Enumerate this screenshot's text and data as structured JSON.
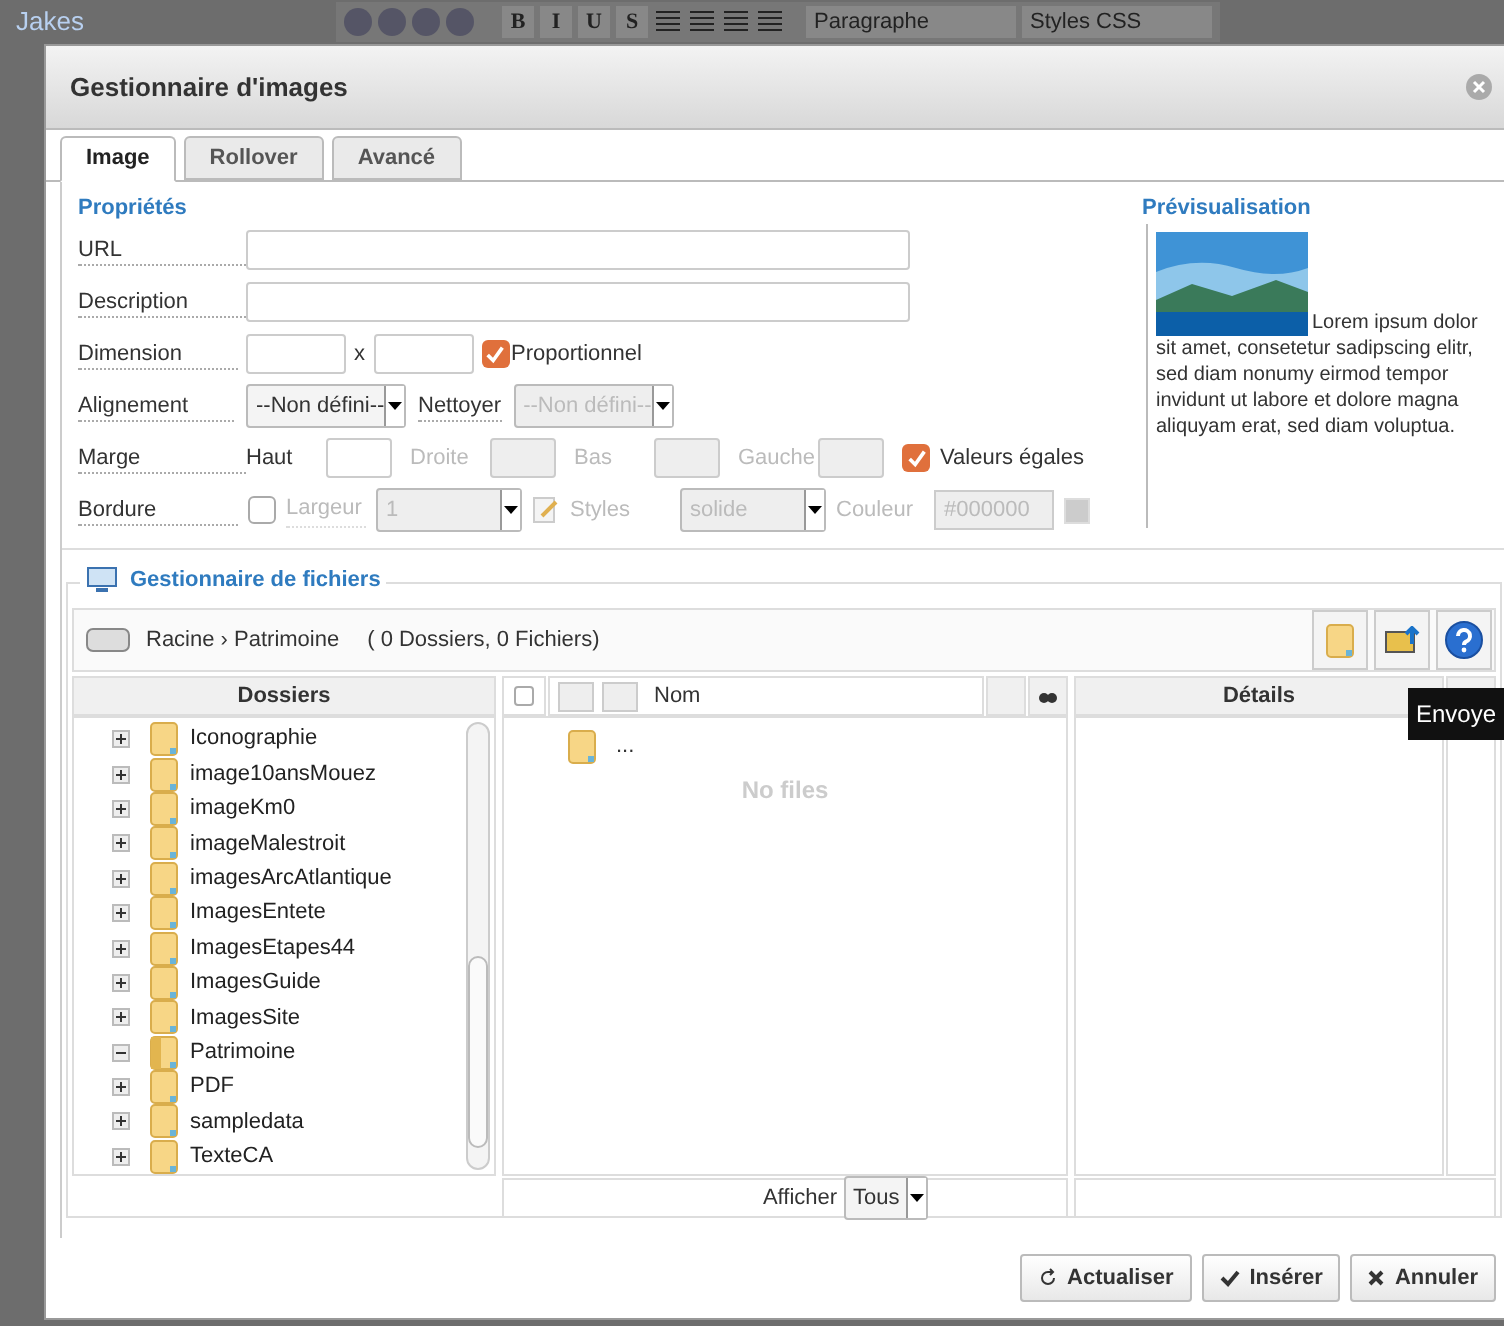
{
  "background": {
    "title": "Jakes",
    "format_buttons": [
      "B",
      "I",
      "U",
      "S"
    ],
    "format_select": "Paragraphe",
    "styles_select": "Styles CSS"
  },
  "dialog": {
    "title": "Gestionnaire d'images",
    "tabs": [
      {
        "label": "Image",
        "selected": true
      },
      {
        "label": "Rollover",
        "selected": false
      },
      {
        "label": "Avancé",
        "selected": false
      }
    ],
    "properties": {
      "legend": "Propriétés",
      "url_label": "URL",
      "description_label": "Description",
      "dimension_label": "Dimension",
      "dimension_separator": "x",
      "proportional": {
        "label": "Proportionnel",
        "checked": true
      },
      "alignment_label": "Alignement",
      "alignment_select": {
        "value": "--Non défini--",
        "disabled": false
      },
      "clear_label": "Nettoyer",
      "clear_select": {
        "value": "--Non défini--",
        "disabled": true
      },
      "margin_label": "Marge",
      "margins": [
        {
          "label": "Haut",
          "disabled": false
        },
        {
          "label": "Droite",
          "disabled": true
        },
        {
          "label": "Bas",
          "disabled": true
        },
        {
          "label": "Gauche",
          "disabled": true
        }
      ],
      "equal_values": {
        "label": "Valeurs égales",
        "checked": true
      },
      "border_label": "Bordure",
      "border": {
        "checked": false,
        "width_label": "Largeur",
        "width_value": "1",
        "style_label": "Styles",
        "style_value": "solide",
        "color_label": "Couleur",
        "color_value": "#000000"
      }
    },
    "preview": {
      "legend": "Prévisualisation",
      "text": "Lorem ipsum dolor sit amet, consetetur sadipscing elitr, sed diam nonumy eirmod tempor invidunt ut labore et dolore magna aliquyam erat, sed diam voluptua."
    },
    "file_manager": {
      "legend": "Gestionnaire de fichiers",
      "path": "Racine › Patrimoine",
      "counts": "( 0 Dossiers, 0 Fichiers)",
      "folders_header": "Dossiers",
      "folders": [
        {
          "name": "Iconographie",
          "expanded": false
        },
        {
          "name": "image10ansMouez",
          "expanded": false
        },
        {
          "name": "imageKm0",
          "expanded": false
        },
        {
          "name": "imageMalestroit",
          "expanded": false
        },
        {
          "name": "imagesArcAtlantique",
          "expanded": false
        },
        {
          "name": "ImagesEntete",
          "expanded": false
        },
        {
          "name": "ImagesEtapes44",
          "expanded": false
        },
        {
          "name": "ImagesGuide",
          "expanded": false
        },
        {
          "name": "ImagesSite",
          "expanded": false
        },
        {
          "name": "Patrimoine",
          "expanded": true
        },
        {
          "name": "PDF",
          "expanded": false
        },
        {
          "name": "sampledata",
          "expanded": false
        },
        {
          "name": "TexteCA",
          "expanded": false
        }
      ],
      "select_all": {
        "checked": false
      },
      "name_header": "Nom",
      "parent_entry": "...",
      "empty_text": "No files",
      "details_header": "Détails",
      "show_label": "Afficher",
      "show_select": "Tous",
      "tooltip": "Envoye"
    },
    "buttons": [
      {
        "kind": "refresh",
        "label": "Actualiser"
      },
      {
        "kind": "insert",
        "label": "Insérer"
      },
      {
        "kind": "cancel",
        "label": "Annuler"
      }
    ]
  }
}
